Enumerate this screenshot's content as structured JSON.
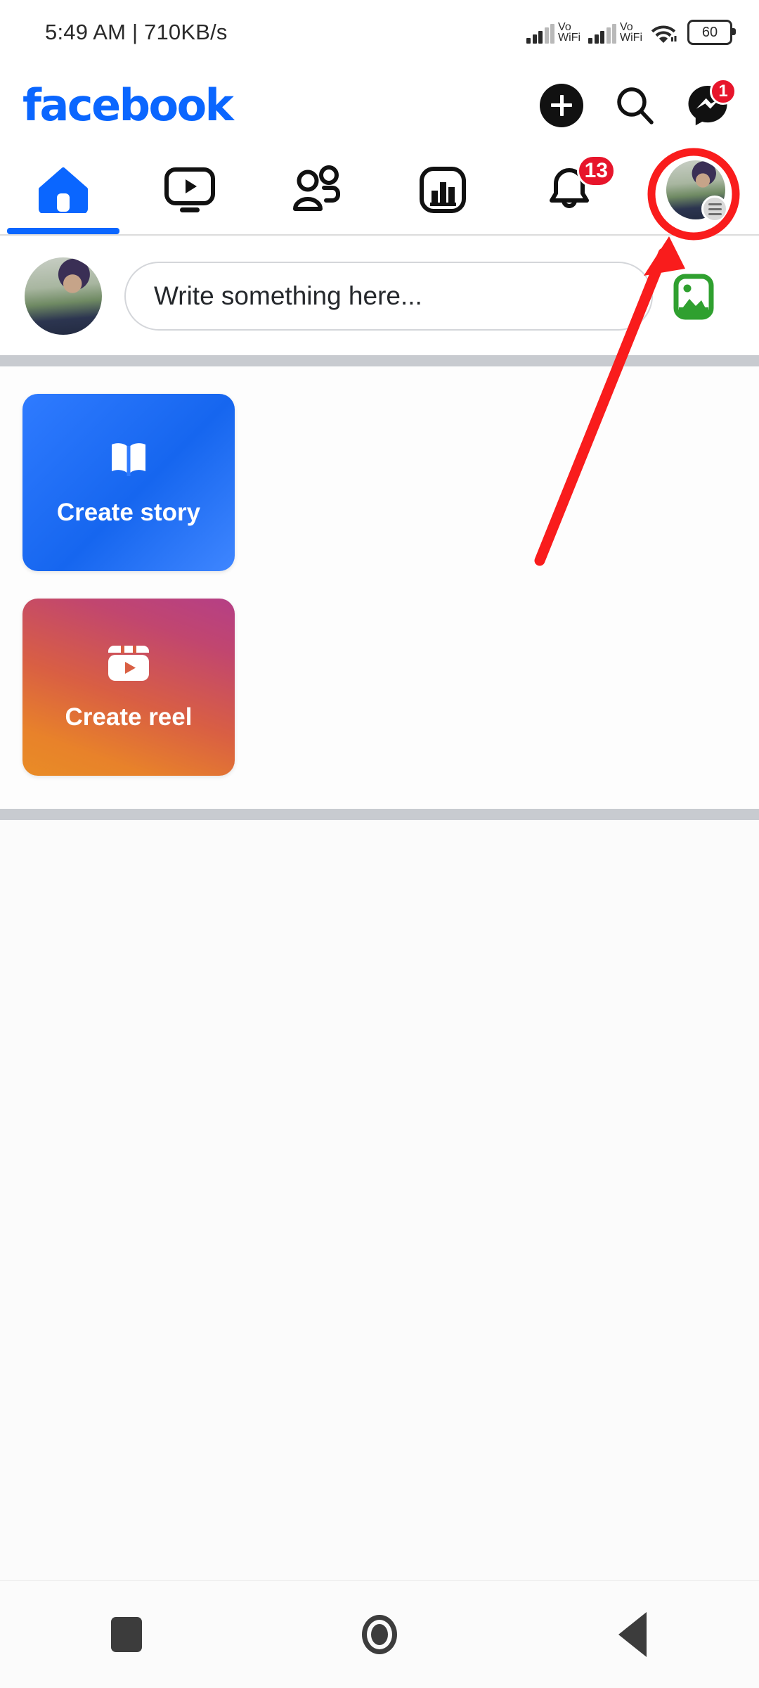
{
  "status_bar": {
    "time_and_speed": "5:49 AM | 710KB/s",
    "sim1_label_top": "Vo",
    "sim1_label_bottom": "WiFi",
    "sim2_label_top": "Vo",
    "sim2_label_bottom": "WiFi",
    "wifi_icon": "wifi-icon",
    "battery_level": "60"
  },
  "header": {
    "logo_text": "facebook",
    "create_icon": "plus-icon",
    "search_icon": "search-icon",
    "messenger_icon": "messenger-icon",
    "messenger_badge": "1"
  },
  "tabs": [
    {
      "name": "home",
      "icon": "home-icon",
      "active": true
    },
    {
      "name": "video",
      "icon": "video-icon",
      "active": false
    },
    {
      "name": "friends",
      "icon": "friends-icon",
      "active": false
    },
    {
      "name": "marketplace",
      "icon": "marketplace-icon",
      "active": false
    },
    {
      "name": "notifications",
      "icon": "bell-icon",
      "active": false,
      "badge": "13"
    },
    {
      "name": "menu-profile",
      "icon": "avatar-menu-icon",
      "active": false
    }
  ],
  "composer": {
    "avatar": "user-avatar",
    "placeholder": "Write something here...",
    "photo_icon": "photo-gallery-icon"
  },
  "stories": {
    "create_story_label": "Create story",
    "create_story_icon": "book-icon",
    "create_reel_label": "Create reel",
    "create_reel_icon": "reel-icon"
  },
  "annotations": {
    "highlight_target": "profile-menu-avatar",
    "highlight_color": "#f91c1c",
    "arrow_color": "#f91c1c"
  },
  "android_nav": {
    "recents_icon": "recents-square-icon",
    "home_icon": "home-circle-icon",
    "back_icon": "back-triangle-icon"
  },
  "colors": {
    "brand_blue": "#0a66ff",
    "badge_red": "#e7152b",
    "annotation_red": "#f91c1c",
    "photo_green": "#33a02c"
  }
}
